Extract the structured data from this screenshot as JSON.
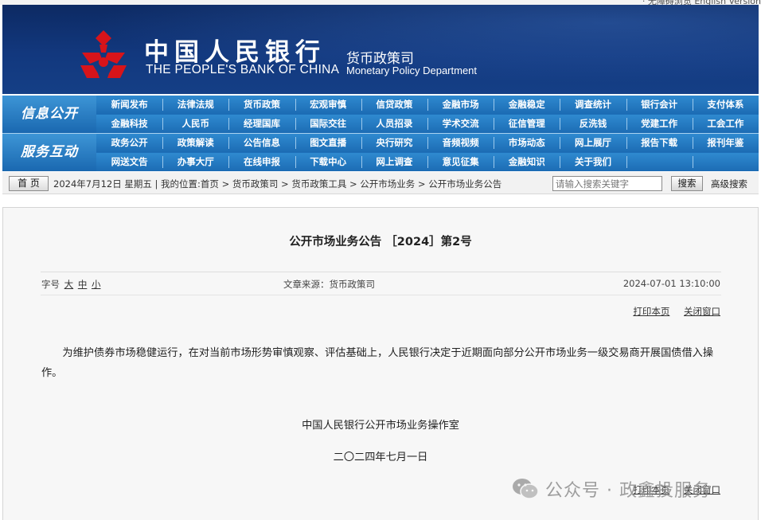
{
  "top_links": {
    "text": "· 无障碍浏览    English Version"
  },
  "header": {
    "bank_name_cn": "中国人民银行",
    "bank_name_en": "THE PEOPLE'S BANK OF CHINA",
    "dept_cn": "货币政策司",
    "dept_en": "Monetary Policy Department"
  },
  "nav": {
    "group1_label": "信息公开",
    "group2_label": "服务互动",
    "row1": [
      "新闻发布",
      "法律法规",
      "货币政策",
      "宏观审慎",
      "信贷政策",
      "金融市场",
      "金融稳定",
      "调查统计",
      "银行会计",
      "支付体系"
    ],
    "row2": [
      "金融科技",
      "人民币",
      "经理国库",
      "国际交往",
      "人员招录",
      "学术交流",
      "征信管理",
      "反洗钱",
      "党建工作",
      "工会工作"
    ],
    "row3": [
      "政务公开",
      "政策解读",
      "公告信息",
      "图文直播",
      "央行研究",
      "音频视频",
      "市场动态",
      "网上展厅",
      "报告下载",
      "报刊年鉴"
    ],
    "row4": [
      "网送文告",
      "办事大厅",
      "在线申报",
      "下载中心",
      "网上调查",
      "意见征集",
      "金融知识",
      "关于我们",
      "",
      ""
    ]
  },
  "breadcrumb": {
    "home": "首 页",
    "text": "2024年7月12日 星期五 | 我的位置:首页 > 货币政策司 > 货币政策工具 > 公开市场业务 > 公开市场业务公告",
    "search_placeholder": "请输入搜索关键字",
    "search_button": "搜索",
    "advanced": "高级搜索"
  },
  "article": {
    "title": "公开市场业务公告 ［2024］第2号",
    "font_size_label": "字号",
    "size_large": "大",
    "size_medium": "中",
    "size_small": "小",
    "source": "文章来源：货币政策司",
    "datetime": "2024-07-01 13:10:00",
    "print": "打印本页",
    "close": "关闭窗口",
    "body": "为维护债券市场稳健运行，在对当前市场形势审慎观察、评估基础上，人民银行决定于近期面向部分公开市场业务一级交易商开展国债借入操作。",
    "signature_org": "中国人民银行公开市场业务操作室",
    "signature_date": "二〇二四年七月一日"
  },
  "watermark": {
    "text": "公众号 · 政鑫投服务"
  },
  "colors": {
    "banner": "#12387e",
    "nav": "#1d6fb8",
    "logo_red": "#d7141a"
  }
}
